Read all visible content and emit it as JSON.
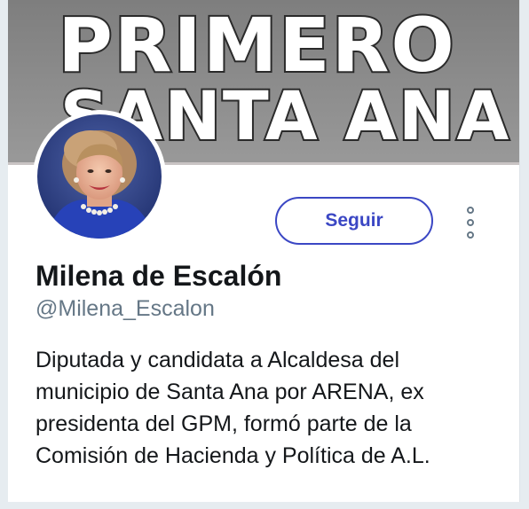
{
  "banner": {
    "line1": "PRIMERO",
    "line2": "SANTA ANA"
  },
  "profile": {
    "name": "Milena de Escalón",
    "handle": "@Milena_Escalon",
    "bio": "Diputada y candidata a Alcaldesa del municipio de Santa Ana por ARENA, ex presidenta del GPM, formó parte de la Comisión de Hacienda y Política de A.L."
  },
  "actions": {
    "follow_label": "Seguir",
    "more_icon": "more-vertical-icon"
  },
  "colors": {
    "accent": "#3b47c4",
    "secondary_text": "#657786",
    "primary_text": "#14171a",
    "background": "#e6ecf0"
  }
}
